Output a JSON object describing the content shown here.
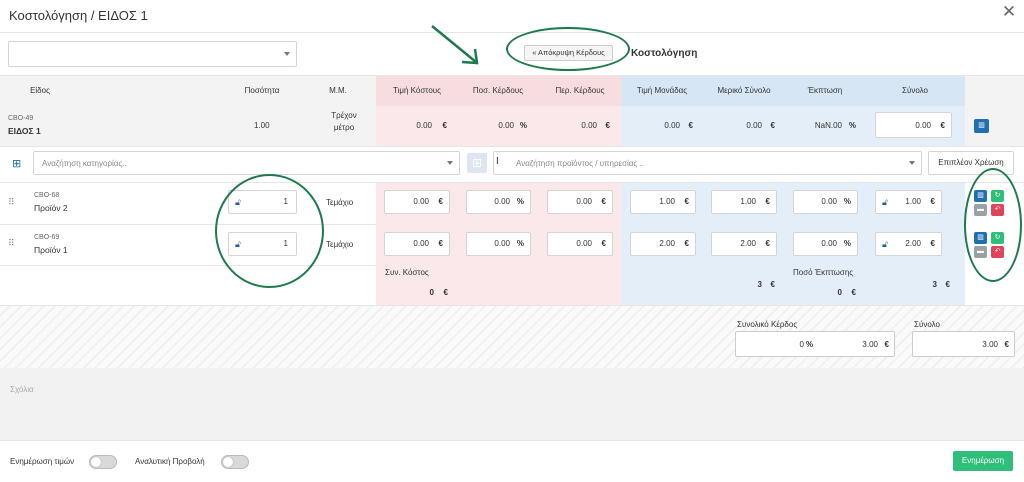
{
  "window": {
    "title": "Κοστολόγηση / ΕΙΔΟΣ 1"
  },
  "toolbar": {
    "hide_profit_label": "Απόκρυψη Κέρδους",
    "section_title": "Κοστολόγηση"
  },
  "headers": {
    "item": "Είδος",
    "quantity": "Ποσότητα",
    "unit": "Μ.Μ.",
    "cost_price": "Τιμή Κόστους",
    "profit_pct": "Ποσ. Κέρδους",
    "profit_margin": "Περ. Κέρδους",
    "unit_price": "Τιμή Μονάδας",
    "subtotal": "Μερικό Σύνολο",
    "discount": "Έκπτωση",
    "total": "Σύνολο"
  },
  "main_item": {
    "code": "CBO-49",
    "name": "ΕΙΔΟΣ 1",
    "quantity": "1.00",
    "unit_line1": "Τρέχον",
    "unit_line2": "μέτρο",
    "cost": "0.00",
    "profit_pct": "0.00",
    "margin": "0.00",
    "unit_price": "0.00",
    "subtotal": "0.00",
    "discount": "NaN.00",
    "total": "0.00"
  },
  "symbols": {
    "euro": "€",
    "percent": "%"
  },
  "search": {
    "category_placeholder": "Αναζήτηση κατηγορίας..",
    "product_placeholder": "Αναζήτηση προϊόντος / υπηρεσίας ..",
    "extra_charge_label": "Επιπλέον Χρέωση"
  },
  "rows": [
    {
      "code": "CBO-68",
      "name": "Προϊόν 2",
      "quantity": "1",
      "unit": "Τεμάχιο",
      "cost": "0.00",
      "profit_pct": "0.00",
      "margin": "0.00",
      "unit_price": "1.00",
      "subtotal": "1.00",
      "discount": "0.00",
      "total": "1.00"
    },
    {
      "code": "CBO-69",
      "name": "Προϊόν 1",
      "quantity": "1",
      "unit": "Τεμάχιο",
      "cost": "0.00",
      "profit_pct": "0.00",
      "margin": "0.00",
      "unit_price": "2.00",
      "subtotal": "2.00",
      "discount": "0.00",
      "total": "2.00"
    }
  ],
  "summary": {
    "total_cost_label": "Συν. Κόστος",
    "total_cost": "0",
    "subtotal_sum": "3",
    "discount_label": "Ποσό Έκπτωσης",
    "discount_sum": "0",
    "total_sum": "3"
  },
  "totals": {
    "profit_label": "Συνολικό Κέρδος",
    "profit_pct": "0",
    "profit_value": "3.00",
    "total_label": "Σύνολο",
    "total_value": "3.00"
  },
  "comments": {
    "placeholder": "Σχόλια"
  },
  "footer": {
    "update_prices_label": "Ενημέρωση τιμών",
    "detailed_view_label": "Αναλυτική Προβολή",
    "update_button": "Ενημέρωση"
  },
  "colors": {
    "accent_green": "#2fbf7a",
    "annotation_green": "#1e7a4c",
    "blue_button": "#1f6fb2",
    "red_button": "#e0445a"
  }
}
